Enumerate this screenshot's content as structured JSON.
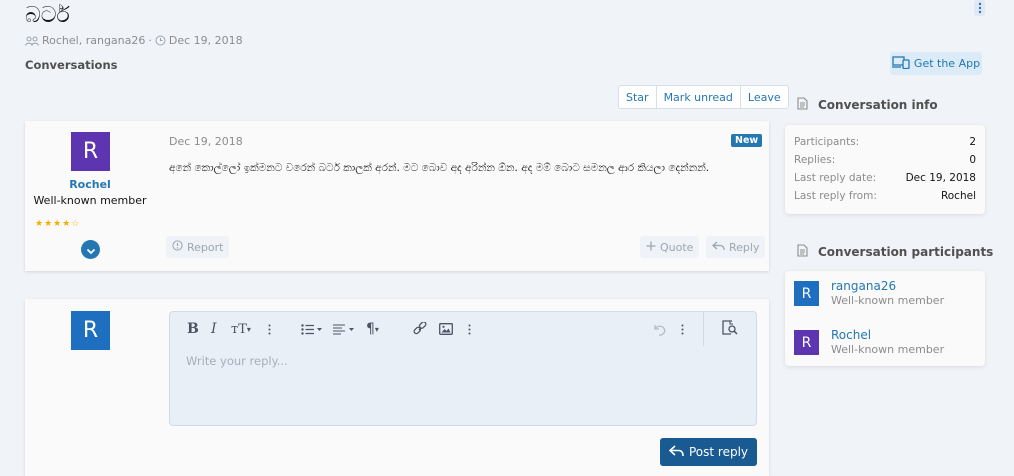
{
  "thread": {
    "title": "බටර්",
    "participants_meta": "Rochel, rangana26",
    "date_meta": "Dec 19, 2018",
    "section_label": "Conversations"
  },
  "header_actions": {
    "get_app_label": "Get the App"
  },
  "conversation_actions": {
    "star_label": "Star",
    "mark_unread_label": "Mark unread",
    "leave_label": "Leave"
  },
  "message": {
    "avatar_letter": "R",
    "username": "Rochel",
    "user_title": "Well-known member",
    "stars": "★★★★☆",
    "date": "Dec 19, 2018",
    "badge": "New",
    "body": "අනේ කොල්ලෝ ඉක්මනට වරෙන් බටර් කාලක් අරන්. මට බොව අද අරින්න ඕන. අද මම් බොට සමනල ආර කියලා දෙන්නන්.",
    "report_label": "Report",
    "quote_label": "Quote",
    "reply_label": "Reply"
  },
  "reply_form": {
    "avatar_letter": "R",
    "placeholder": "Write your reply...",
    "post_label": "Post reply"
  },
  "sidebar": {
    "info_heading": "Conversation info",
    "info": [
      {
        "label": "Participants:",
        "value": "2"
      },
      {
        "label": "Replies:",
        "value": "0"
      },
      {
        "label": "Last reply date:",
        "value": "Dec 19, 2018"
      },
      {
        "label": "Last reply from:",
        "value": "Rochel"
      }
    ],
    "participants_heading": "Conversation participants",
    "participants": [
      {
        "letter": "R",
        "name": "rangana26",
        "title": "Well-known member",
        "color": "#1e6fbf"
      },
      {
        "letter": "R",
        "name": "Rochel",
        "title": "Well-known member",
        "color": "#5e35b1"
      }
    ]
  },
  "colors": {
    "accent": "#2577b1",
    "primary_button": "#195a93",
    "page_bg": "#f0f3f8"
  }
}
